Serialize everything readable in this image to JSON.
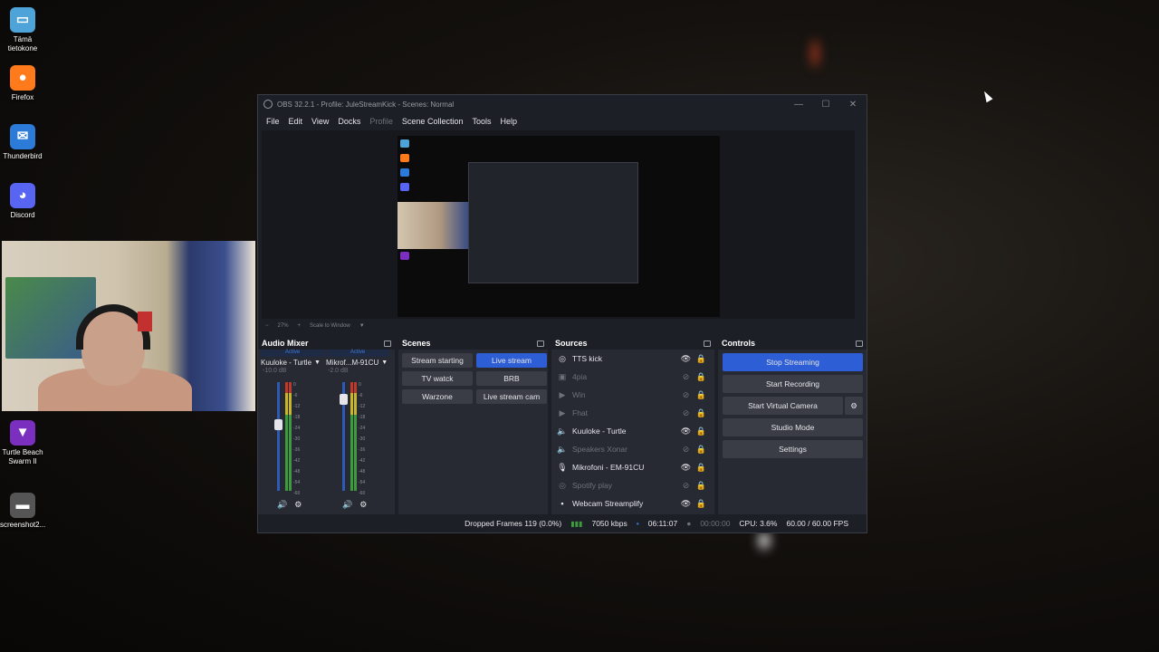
{
  "desktop": {
    "icons": [
      {
        "label": "Tämä tietokone",
        "icon": "computer-icon",
        "color": "#4ea3d8"
      },
      {
        "label": "Firefox",
        "icon": "firefox-icon",
        "color": "#ff7a1a"
      },
      {
        "label": "Thunderbird",
        "icon": "thunderbird-icon",
        "color": "#2d7bd8"
      },
      {
        "label": "Discord",
        "icon": "discord-icon",
        "color": "#5865f2"
      },
      {
        "label": "Turtle Beach Swarm II",
        "icon": "turtle-beach-icon",
        "color": "#7b2fbf"
      },
      {
        "label": "screenshot2...",
        "icon": "image-file-icon",
        "color": "#555555"
      }
    ]
  },
  "obs": {
    "title": "OBS 32.2.1 - Profile: JuleStreamKick - Scenes: Normal",
    "menu": [
      "File",
      "Edit",
      "View",
      "Docks",
      "Profile",
      "Scene Collection",
      "Tools",
      "Help"
    ],
    "zoom": {
      "minus": "−",
      "level": "27%",
      "plus": "+",
      "mode": "Scale to Window"
    },
    "audio_mixer": {
      "title": "Audio Mixer",
      "channels": [
        {
          "active": "Active",
          "name": "Kuuloke - Turtle",
          "db": "-10.0 dB",
          "volume_level": 0.62
        },
        {
          "active": "Active",
          "name": "Mikrof...M-91CU",
          "db": "-2.0 dB",
          "volume_level": 0.88
        }
      ],
      "ticks": [
        "0",
        "-6",
        "-12",
        "-18",
        "-24",
        "-30",
        "-36",
        "-42",
        "-48",
        "-54",
        "-60"
      ]
    },
    "scenes": {
      "title": "Scenes",
      "items": [
        "Stream starting",
        "Live stream",
        "TV watck",
        "BRB",
        "Warzone",
        "Live stream cam"
      ],
      "selected": "Live stream"
    },
    "sources": {
      "title": "Sources",
      "items": [
        {
          "name": "TTS kick",
          "icon": "browser-icon",
          "visible": true
        },
        {
          "name": "4pia",
          "icon": "image-icon",
          "visible": false
        },
        {
          "name": "Win",
          "icon": "media-icon",
          "visible": false
        },
        {
          "name": "Fhat",
          "icon": "media-icon",
          "visible": false
        },
        {
          "name": "Kuuloke - Turtle",
          "icon": "speaker-icon",
          "visible": true
        },
        {
          "name": "Speakers Xonar",
          "icon": "speaker-icon",
          "visible": false
        },
        {
          "name": "Mikrofoni - EM-91CU",
          "icon": "microphone-icon",
          "visible": true
        },
        {
          "name": "Spotify play",
          "icon": "browser-icon",
          "visible": false
        },
        {
          "name": "Webcam Streamplify",
          "icon": "camera-icon",
          "visible": true
        }
      ]
    },
    "controls": {
      "title": "Controls",
      "stop_streaming": "Stop Streaming",
      "start_recording": "Start Recording",
      "start_virtual_camera": "Start Virtual Camera",
      "studio_mode": "Studio Mode",
      "settings": "Settings"
    },
    "status": {
      "dropped_frames": "Dropped Frames 119 (0.0%)",
      "bitrate": "7050 kbps",
      "stream_time": "06:11:07",
      "record_time": "00:00:00",
      "cpu": "CPU: 3.6%",
      "fps": "60.00 / 60.00 FPS"
    }
  }
}
